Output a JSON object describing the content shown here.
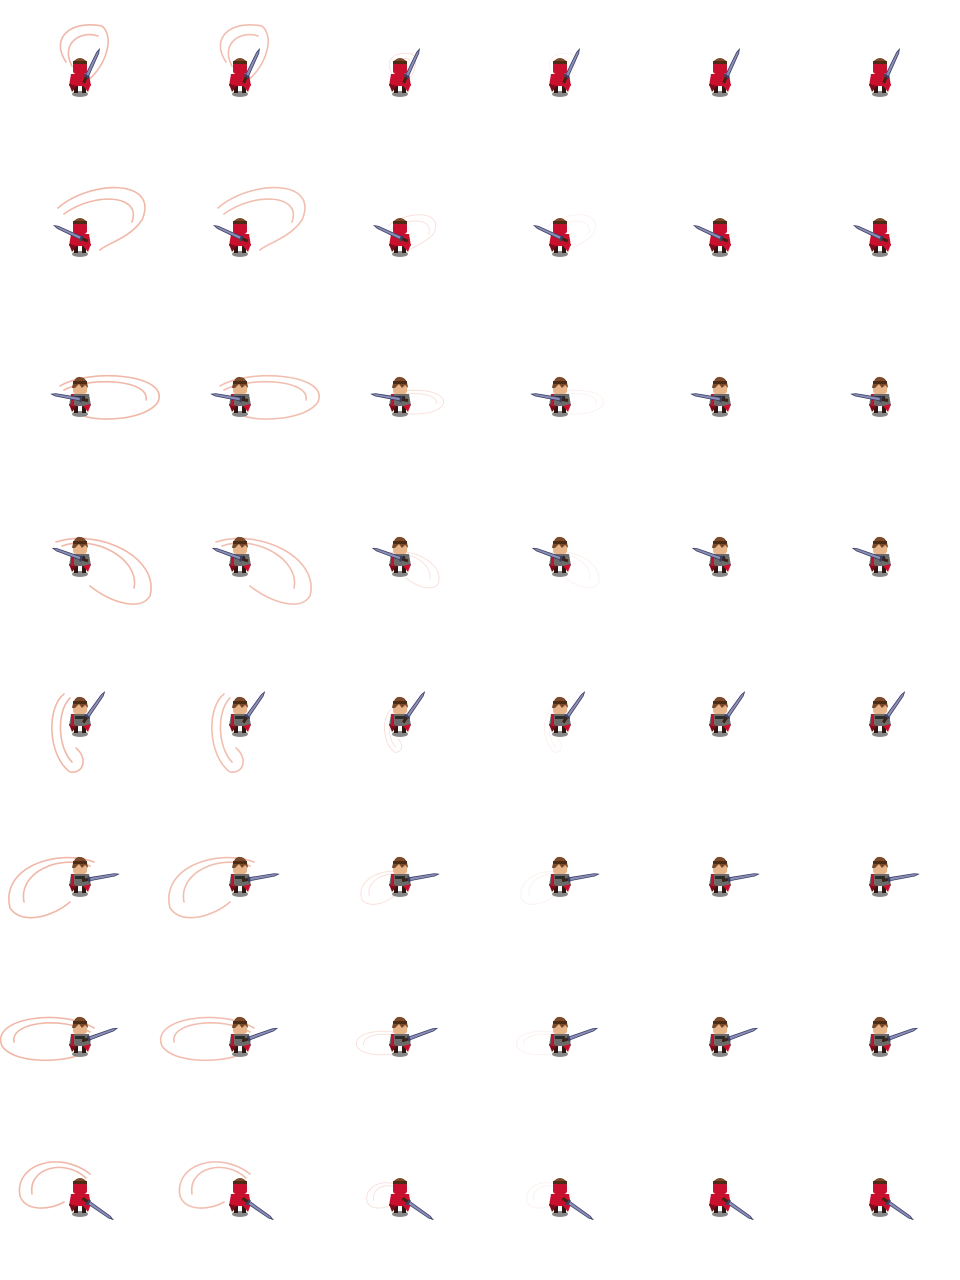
{
  "sheet": {
    "columns": 6,
    "rows": 8,
    "colors": {
      "background": "#ffffff",
      "cloak": "#c8102e",
      "cloak_dark": "#7a0c1c",
      "hair": "#7a4a2a",
      "hair_dark": "#4d2c16",
      "skin": "#e8b48a",
      "armor": "#6b6b6b",
      "armor_dark": "#2e2b2b",
      "boots": "#2a1a12",
      "blade": "#8a8fb8",
      "blade_edge": "#3c3f66",
      "hilt": "#3a2412",
      "shadow": "#555555",
      "trail": "#f0b8a8"
    },
    "frame_trail_strength": [
      1.0,
      0.9,
      0.45,
      0.2,
      0.0,
      0.0
    ],
    "directions": [
      {
        "facing": "back",
        "sword_angle": -65,
        "trail": "loop-up"
      },
      {
        "facing": "back-left",
        "sword_angle": -155,
        "trail": "loop-right"
      },
      {
        "facing": "left",
        "sword_angle": -170,
        "trail": "flat-right"
      },
      {
        "facing": "front-left",
        "sword_angle": -160,
        "trail": "loop-down-right"
      },
      {
        "facing": "front",
        "sword_angle": -55,
        "trail": "loop-left-down"
      },
      {
        "facing": "front-right",
        "sword_angle": -10,
        "trail": "loop-left"
      },
      {
        "facing": "right",
        "sword_angle": -20,
        "trail": "flat-left"
      },
      {
        "facing": "back-right",
        "sword_angle": 35,
        "trail": "loop-up-left"
      }
    ]
  }
}
